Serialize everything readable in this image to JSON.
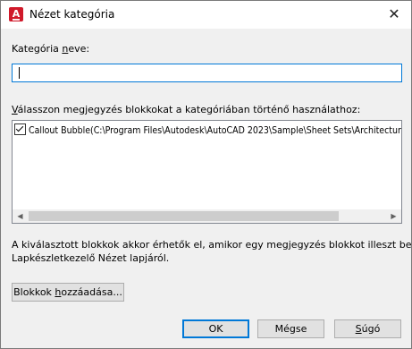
{
  "window": {
    "title": "Nézet kategória",
    "icon_letter": "A",
    "icon_color": "#d0192a"
  },
  "name_field": {
    "label_prefix": "Kategória ",
    "label_mnemonic": "n",
    "label_suffix": "eve:",
    "value": ""
  },
  "blocks": {
    "label_mnemonic": "V",
    "label_rest": "álasszon megjegyzés blokkokat a kategóriában történő használathoz:",
    "items": [
      {
        "label": "Callout Bubble(C:\\Program Files\\Autodesk\\AutoCAD 2023\\Sample\\Sheet Sets\\Architectural\\",
        "checked": true
      }
    ]
  },
  "info_text_line1": "A kiválasztott blokkok akkor érhetők el, amikor egy megjegyzés blokkot illeszt be a",
  "info_text_line2": "Lapkészletkezelő Nézet lapjáról.",
  "add_button": {
    "prefix": "Blokkok ",
    "mnemonic": "h",
    "suffix": "ozzáadása..."
  },
  "ok_label": "OK",
  "cancel_label": "Mégse",
  "help_label": {
    "mnemonic": "S",
    "rest": "úgó"
  }
}
